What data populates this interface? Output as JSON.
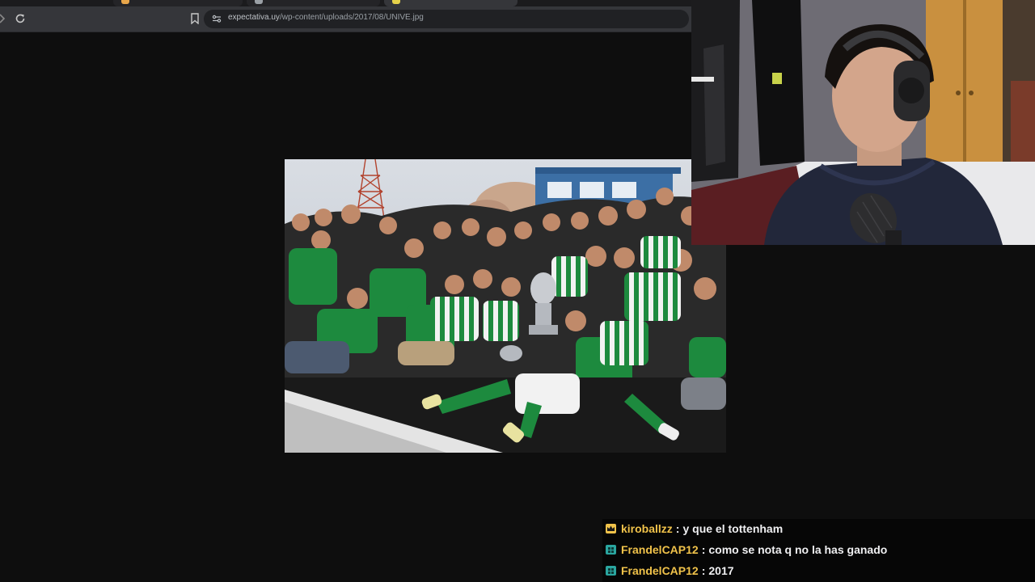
{
  "browser": {
    "url_domain": "expectativa.uy",
    "url_path": "/wp-content/uploads/2017/08/UNIVE.jpg"
  },
  "icons": {
    "back": "chevron-right-icon",
    "reload": "reload-icon",
    "bookmark": "bookmark-icon",
    "site_settings": "site-settings-icon"
  },
  "colors": {
    "jersey_green": "#1d8a3e",
    "accent_gold": "#f0c24a",
    "accent_teal": "#5cd6c8"
  },
  "chat": {
    "messages": [
      {
        "badge": "crown-badge-icon",
        "user": "kiroballzz",
        "separator": ":",
        "text": "y que el tottenham"
      },
      {
        "badge": "sub-badge-icon",
        "user": "FrandelCAP12",
        "separator": ":",
        "text": "como se nota q no la has ganado"
      },
      {
        "badge": "sub-badge-icon",
        "user": "FrandelCAP12",
        "separator": ":",
        "text": "2017"
      }
    ]
  }
}
